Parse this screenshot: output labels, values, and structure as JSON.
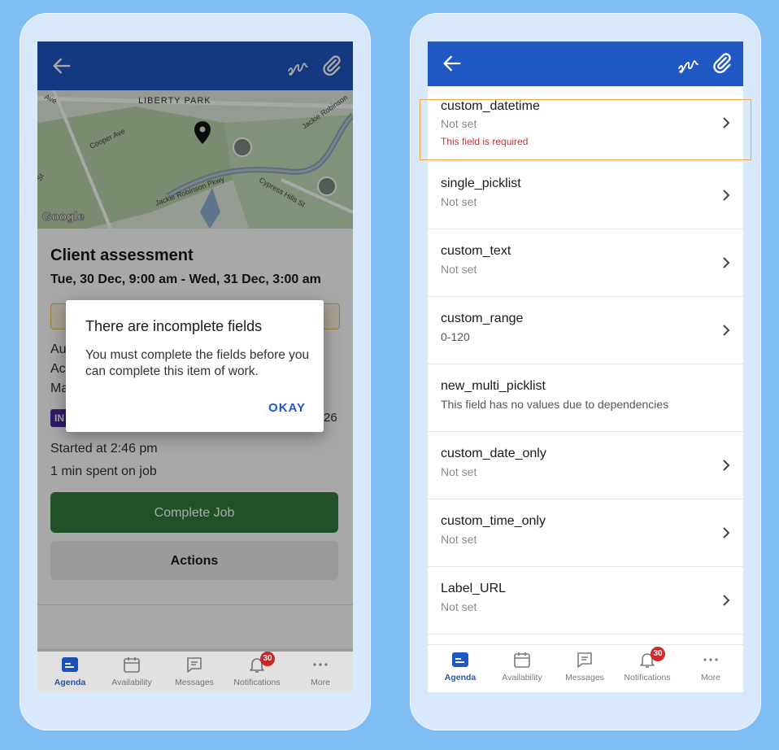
{
  "left": {
    "map": {
      "labels": [
        "LIBERTY PARK",
        "Cooper Ave",
        "Jackie Robinson Pkwy",
        "Cypress Hills St",
        "Jackie Robinson",
        "Ave",
        "St",
        "Google"
      ]
    },
    "job": {
      "title": "Client assessment",
      "date_range": "Tue, 30 Dec, 9:00 am - Wed, 31 Dec, 3:00 am",
      "partial_lines": [
        "Au",
        "Ac",
        "Ma"
      ],
      "status_badge": "IN",
      "side_text": "26",
      "started": "Started at 2:46 pm",
      "spent": "1 min spent on job",
      "complete_label": "Complete Job",
      "actions_label": "Actions"
    },
    "dialog": {
      "title": "There are incomplete fields",
      "body": "You must complete the fields before you can complete this item of work.",
      "ok_label": "OKAY"
    }
  },
  "right": {
    "fields": [
      {
        "name": "custom_datetime",
        "value": "Not set",
        "error": "This field is required",
        "has_chevron": true
      },
      {
        "name": "single_picklist",
        "value": "Not set",
        "has_chevron": true
      },
      {
        "name": "custom_text",
        "value": "Not set",
        "has_chevron": true
      },
      {
        "name": "custom_range",
        "value": "0-120",
        "has_chevron": true
      },
      {
        "name": "new_multi_picklist",
        "value": "This field has no values due to dependencies",
        "has_chevron": false
      },
      {
        "name": "custom_date_only",
        "value": "Not set",
        "has_chevron": true
      },
      {
        "name": "custom_time_only",
        "value": "Not set",
        "has_chevron": true
      },
      {
        "name": "Label_URL",
        "value": "Not set",
        "has_chevron": true
      }
    ]
  },
  "tabs": [
    {
      "label": "Agenda",
      "icon": "agenda-icon",
      "active": true
    },
    {
      "label": "Availability",
      "icon": "calendar-icon"
    },
    {
      "label": "Messages",
      "icon": "message-icon"
    },
    {
      "label": "Notifications",
      "icon": "bell-icon",
      "badge": "30"
    },
    {
      "label": "More",
      "icon": "more-icon"
    }
  ],
  "colors": {
    "primary": "#1f57c3",
    "complete_green": "#2f7d3a",
    "error_red": "#c23434",
    "highlight_orange": "#f0a640",
    "background": "#7fbdf2"
  }
}
